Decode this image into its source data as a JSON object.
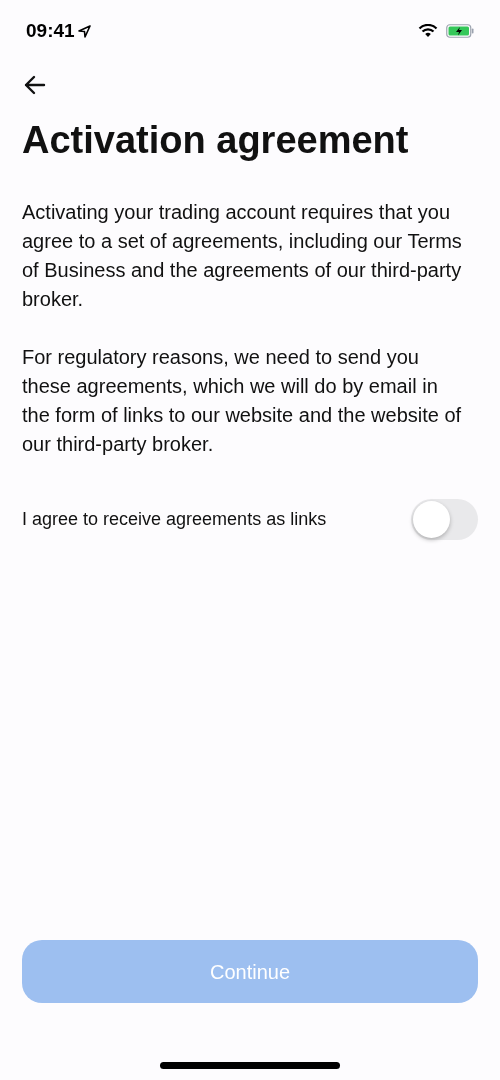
{
  "status_bar": {
    "time": "09:41"
  },
  "title": "Activation agreement",
  "paragraphs": [
    "Activating your trading account requires that you agree to a set of agreements, including our Terms of Business and the agreements of our third-party broker.",
    "For regulatory reasons, we need to send you these agreements, which we will do by email in the form of links to our website and the website of our third-party broker."
  ],
  "toggle": {
    "label": "I agree to receive agreements as links",
    "on": false
  },
  "continue_button": {
    "label": "Continue",
    "disabled": true
  }
}
